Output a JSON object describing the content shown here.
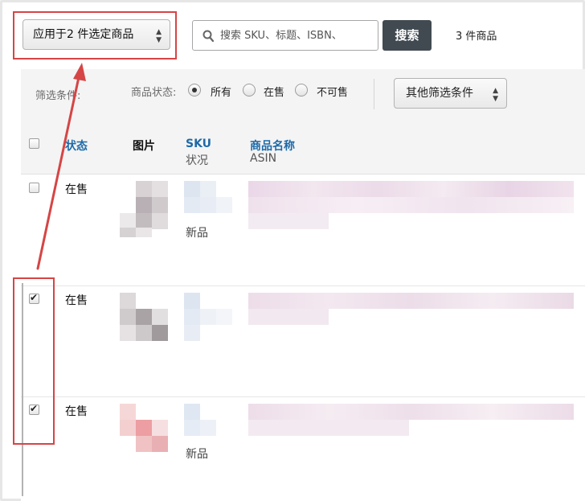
{
  "toolbar": {
    "action_select_label": "应用于2 件选定商品",
    "search_placeholder": "搜索 SKU、标题、ISBN、",
    "search_button": "搜索",
    "item_count": "3 件商品"
  },
  "filters": {
    "label": "筛选条件:",
    "status_label": "商品状态:",
    "options": [
      "所有",
      "在售",
      "不可售"
    ],
    "selected": "所有",
    "more_button": "其他筛选条件"
  },
  "table": {
    "headers": {
      "status": "状态",
      "image": "图片",
      "sku": "SKU",
      "sku_sub": "状况",
      "name": "商品名称",
      "name_sub": "ASIN"
    },
    "rows": [
      {
        "checked": false,
        "status": "在售",
        "condition": "新品"
      },
      {
        "checked": true,
        "status": "在售",
        "condition": ""
      },
      {
        "checked": true,
        "status": "在售",
        "condition": "新品"
      }
    ]
  },
  "colors": {
    "annotation_red": "#d64545",
    "link_blue": "#1d6aa8",
    "search_button_bg": "#414a51"
  }
}
